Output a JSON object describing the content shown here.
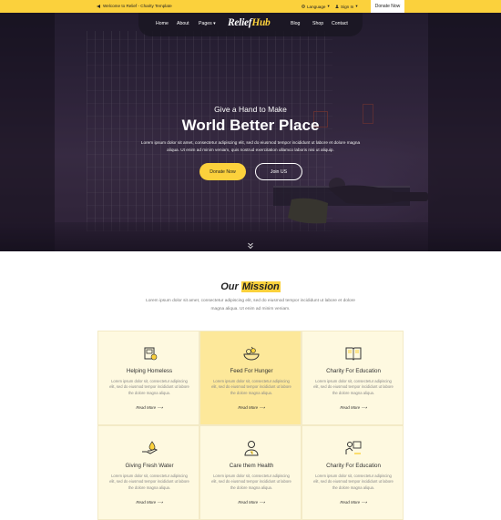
{
  "topbar": {
    "welcome": "Welcome to Relief - Charity Template",
    "language": "Language",
    "signin": "Sign In",
    "donate": "Donate Now"
  },
  "nav": {
    "home": "Home",
    "about": "About",
    "pages": "Pages",
    "logo_a": "Relief",
    "logo_b": "Hub",
    "blog": "Blog",
    "shop": "Shop",
    "contact": "Contact"
  },
  "hero": {
    "subtitle": "Give a Hand to Make",
    "title": "World Better Place",
    "description": "Lorem ipsum dolor sit amet, consectetur adipiscing elit, sed do eiusmod tempor incididunt ut labore et dolore magna aliqua. Ut enim ad minim veniam, quis nostrud exercitation ullamco laboris nisi ut aliquip.",
    "donate_label": "Donate Now",
    "join_label": "Join US"
  },
  "mission": {
    "title_a": "Our",
    "title_b": "Mission",
    "description": "Lorem ipsum dolor sit amet, consectetur adipiscing elit, sed do eiusmod tempor incididunt ut labore et dolore magna aliqua. Ut enim ad minim veniam.",
    "cards": [
      {
        "title": "Helping Homeless",
        "text": "Lorem ipsum dolor sit, consectetur adipiscing elit, sed do eiusmod tempor incididunt ut labore the dolore magna aliqua.",
        "link": "Read More ⟶",
        "icon": "homeless-icon"
      },
      {
        "title": "Feed For Hunger",
        "text": "Lorem ipsum dolor sit, consectetur adipiscing elit, sed do eiusmod tempor incididunt ut labore the dolore magna aliqua.",
        "link": "Read More ⟶",
        "icon": "food-bowl-icon"
      },
      {
        "title": "Charity For Education",
        "text": "Lorem ipsum dolor sit, consectetur adipiscing elit, sed do eiusmod tempor incididunt ut labore the dolore magna aliqua.",
        "link": "Read More ⟶",
        "icon": "book-icon"
      },
      {
        "title": "Giving Fresh Water",
        "text": "Lorem ipsum dolor sit, consectetur adipiscing elit, sed do eiusmod tempor incididunt ut labore the dolore magna aliqua.",
        "link": "Read More ⟶",
        "icon": "water-hand-icon"
      },
      {
        "title": "Care them Health",
        "text": "Lorem ipsum dolor sit, consectetur adipiscing elit, sed do eiusmod tempor incididunt ut labore the dolore magna aliqua.",
        "link": "Read More ⟶",
        "icon": "doctor-icon"
      },
      {
        "title": "Charity For Education",
        "text": "Lorem ipsum dolor sit, consectetur adipiscing elit, sed do eiusmod tempor incididunt ut labore the dolore magna aliqua.",
        "link": "Read More ⟶",
        "icon": "teacher-icon"
      }
    ]
  },
  "colors": {
    "accent": "#fbd13c",
    "card_bg": "#fef9e0",
    "card_active": "#fde89a"
  }
}
